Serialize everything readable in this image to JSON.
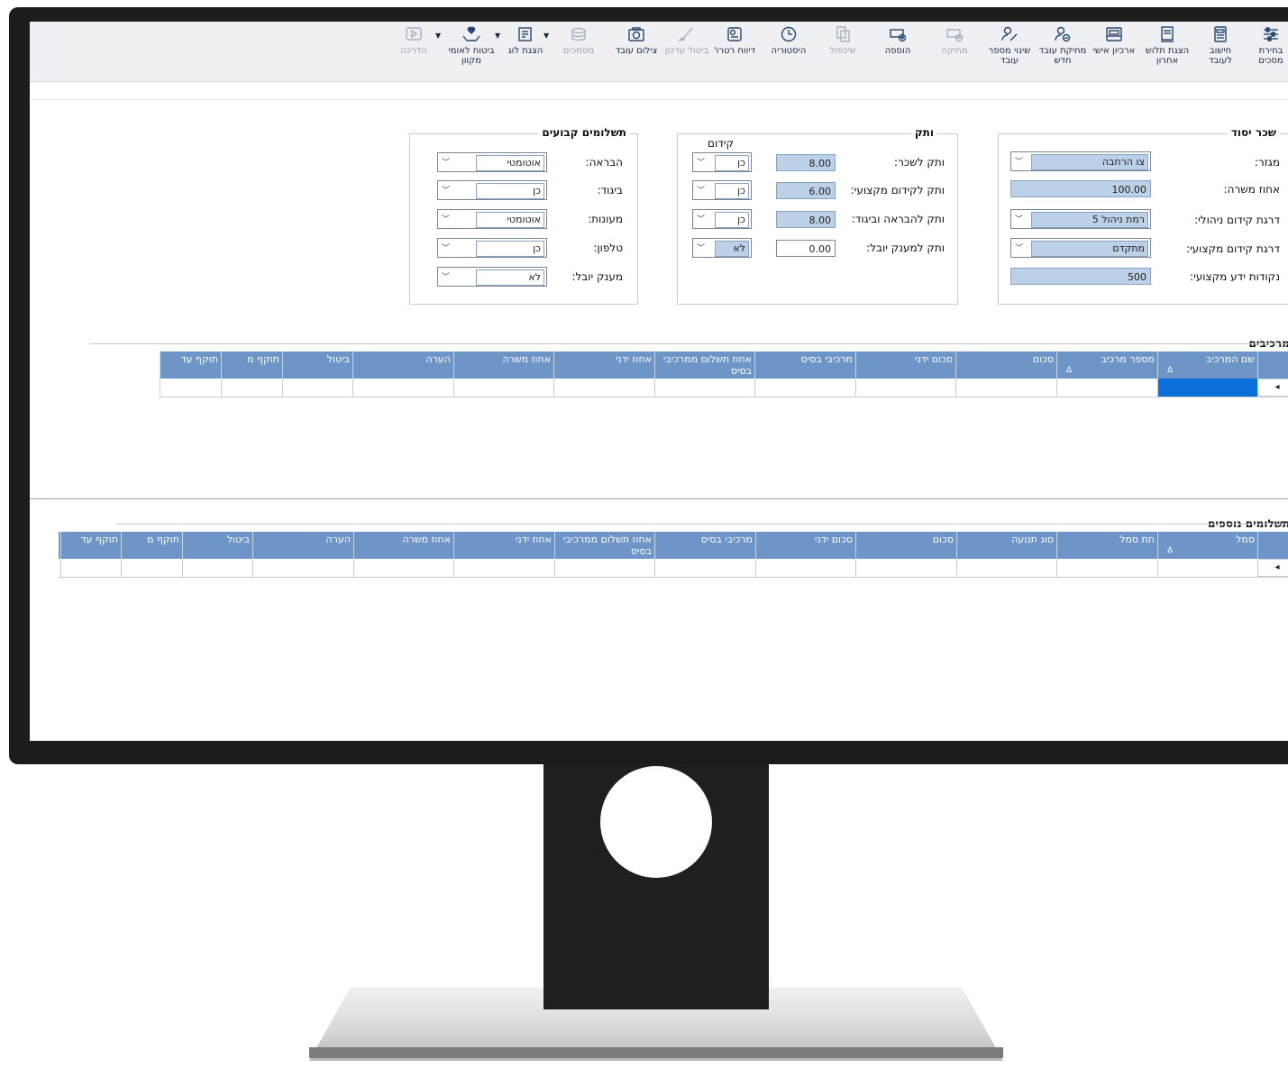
{
  "toolbar": [
    {
      "id": "select-templates",
      "label": "בחירת מסכים",
      "icon": "sliders-icon",
      "enabled": true
    },
    {
      "id": "calc-employee",
      "label": "חישוב לעובד",
      "icon": "calculator-doc-icon",
      "enabled": true
    },
    {
      "id": "last-payslip",
      "label": "הצגת תלוש אחרון",
      "icon": "payslip-icon",
      "enabled": true
    },
    {
      "id": "personal-archive",
      "label": "ארכיון אישי",
      "icon": "archive-icon",
      "enabled": true
    },
    {
      "id": "delete-new-employee",
      "label": "מחיקת עובד חדש",
      "icon": "user-remove-icon",
      "enabled": true
    },
    {
      "id": "change-employee-number",
      "label": "שינוי מספר עובד",
      "icon": "user-edit-icon",
      "enabled": true
    },
    {
      "id": "delete",
      "label": "מחיקה",
      "icon": "delete-icon",
      "enabled": false
    },
    {
      "id": "add",
      "label": "הוספה",
      "icon": "add-icon",
      "enabled": true
    },
    {
      "id": "duplicate",
      "label": "שיכפול",
      "icon": "copy-icon",
      "enabled": false
    },
    {
      "id": "history",
      "label": "היסטוריה",
      "icon": "clock-icon",
      "enabled": true
    },
    {
      "id": "retro-report",
      "label": "דיווח רטרו'",
      "icon": "report-icon",
      "enabled": true
    },
    {
      "id": "cancel-update",
      "label": "ביטול עדכון",
      "icon": "brush-icon",
      "enabled": false
    },
    {
      "id": "employee-photo",
      "label": "צילום עובד",
      "icon": "camera-icon",
      "enabled": true
    },
    {
      "id": "documents",
      "label": "מסמכים",
      "icon": "documents-icon",
      "enabled": false
    },
    {
      "id": "show-log",
      "label": "הצגת לוג",
      "icon": "log-icon",
      "enabled": true
    },
    {
      "id": "social-security",
      "label": "ביטוח לאומי מקוון",
      "icon": "hands-heart-icon",
      "enabled": true
    },
    {
      "id": "guide",
      "label": "הדרכה",
      "icon": "play-icon",
      "enabled": false
    }
  ],
  "base_salary": {
    "title": "שכר יסוד",
    "sector_label": "מגזר:",
    "sector_value": "צו הרחבה",
    "percent_label": "אחוז משרה:",
    "percent_value": "100.00",
    "mgmt_label": "דרגת קידום ניהולי:",
    "mgmt_value": "רמת ניהול 5",
    "prof_label": "דרגת קידום מקצועי:",
    "prof_value": "מתקדם",
    "points_label": "נקודות ידע מקצועי:",
    "points_value": "500"
  },
  "seniority": {
    "title": "ותק",
    "promotion_header": "קידום",
    "rows": [
      {
        "label": "ותק לשכר:",
        "value": "8.00",
        "promo": "כן",
        "blue": true
      },
      {
        "label": "ותק לקידום מקצועי:",
        "value": "6.00",
        "promo": "כן",
        "blue": true
      },
      {
        "label": "ותק להבראה וביגוד:",
        "value": "8.00",
        "promo": "כן",
        "blue": true
      },
      {
        "label": "ותק למענק יובל:",
        "value": "0.00",
        "promo": "לא",
        "blue": false
      }
    ]
  },
  "fixed_payments": {
    "title": "תשלומים קבועים",
    "rows": [
      {
        "label": "הבראה:",
        "value": "אוטומטי"
      },
      {
        "label": "ביגוד:",
        "value": "כן"
      },
      {
        "label": "מעונות:",
        "value": "אוטומטי"
      },
      {
        "label": "טלפון:",
        "value": "כן"
      },
      {
        "label": "מענק יובל:",
        "value": "לא"
      }
    ]
  },
  "components": {
    "title": "מרכיבים",
    "columns": [
      "שם המרכיב",
      "מספר מרכיב",
      "סכום",
      "סכום ידני",
      "מרכיבי בסיס",
      "אחוז תשלום ממרכיבי בסיס",
      "אחוז ידני",
      "אחוז משרה",
      "הערה",
      "ביטול",
      "תוקף מ",
      "תוקף עד"
    ],
    "sort_glyph": "Δ",
    "row_marker": "◂"
  },
  "extra_payments": {
    "title": "תשלומים נוספים",
    "columns": [
      "סמל",
      "תת סמל",
      "סוג תנועה",
      "סכום",
      "סכום ידני",
      "מרכיבי בסיס",
      "אחוז תשלום ממרכיבי בסיס",
      "אחוז ידני",
      "אחוז משרה",
      "הערה",
      "ביטול",
      "תוקף מ",
      "תוקף עד"
    ],
    "sort_glyph": "Δ",
    "row_marker": "◂"
  },
  "colors": {
    "grid_header": "#6d95c8",
    "field_fill": "#bcd0e8",
    "selection": "#0a6fd9",
    "bezel": "#1c1c1c"
  }
}
